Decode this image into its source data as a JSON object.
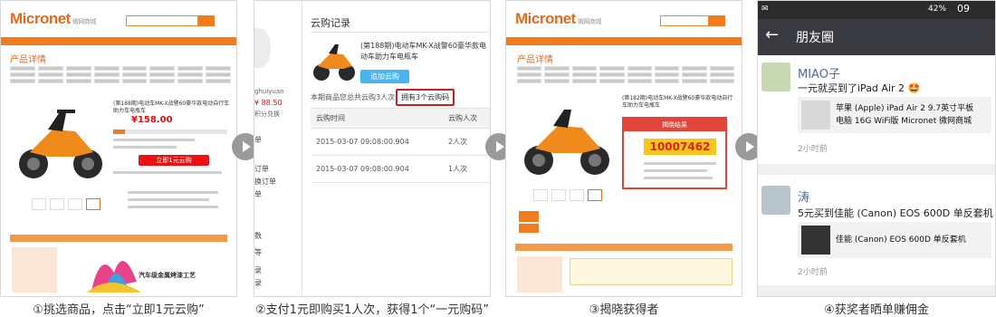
{
  "captions": [
    "①挑选商品，点击“立即1元云购”",
    "②支付1元即购买1人次，获得1个“一元购码”",
    "③揭晓获得者",
    "④获奖者晒单赚佣金"
  ],
  "panel1": {
    "logo": "Micronet",
    "logo_sub": "微网商城",
    "section_title": "产品详情",
    "product_title": "(第188期)电动车MK-X战警60豪华款电动自行车助力车电瓶车",
    "price": "¥158.00",
    "buy_label": "立即1元云购",
    "banner_text": "汽车级金属烤漆工艺"
  },
  "panel2": {
    "title": "云购记录",
    "username": "ghuiyuan",
    "balance": "¥ 88.50",
    "points": "积分兑换",
    "product_title": "(第188期)电动车MK-X战警60豪华款电动车助力车电瓶车",
    "add_button": "追加云购",
    "summary": "本期商品您总共云购3人次",
    "codes": "拥有3个云购码",
    "table_headers": [
      "云购时间",
      "云购人次"
    ],
    "rows": [
      {
        "time": "2015-03-07 09:08:00.904",
        "count": "2人次"
      },
      {
        "time": "2015-03-07 09:08:00.904",
        "count": "1人次"
      }
    ],
    "side_labels": [
      "单",
      "订单",
      "换订单",
      "单",
      "数",
      "等",
      "录",
      "录"
    ]
  },
  "panel3": {
    "logo": "Micronet",
    "logo_sub": "微网商城",
    "section_title": "产品详情",
    "product_title": "(第182期)电动车MK-X战警60豪华款电动自行车助力车电瓶车",
    "result_head": "揭晓结果",
    "lucky_code": "10007462"
  },
  "panel4": {
    "status_time": "09",
    "battery": "42%",
    "title": "朋友圈",
    "posts": [
      {
        "name": "MIAO子",
        "text": "一元就买到了iPad Air 2 🤩",
        "share_line1": "苹果 (Apple) iPad Air 2 9.7英寸平板",
        "share_line2": "电脑 16G WiFi版  Micronet 微网商城",
        "time": "2小时前"
      },
      {
        "name": "涛",
        "text": "5元买到佳能 (Canon) EOS 600D 单反套机",
        "share_line1": "佳能 (Canon) EOS 600D 单反套机",
        "share_line2": "",
        "time": "2小时前"
      }
    ]
  },
  "colors": {
    "brand_orange": "#f07c1e",
    "buy_red": "#e11111",
    "highlight_red": "#cc1f1f",
    "wechat_bar": "#393a3f",
    "wechat_name": "#576b95"
  }
}
